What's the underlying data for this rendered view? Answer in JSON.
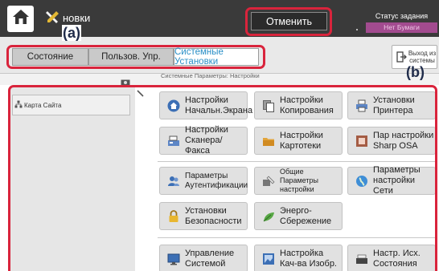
{
  "header": {
    "title": "новки",
    "cancel_label": "Отменить",
    "job_status_title": "Статус задания",
    "job_status_value": "Нет Бумаги"
  },
  "annotations": {
    "a": "(a)",
    "b": "(b)"
  },
  "tabs": [
    {
      "label": "Состояние"
    },
    {
      "label": "Пользов. Упр."
    },
    {
      "label": "Системные Установки",
      "active": true
    }
  ],
  "exit": {
    "label_line1": "Выход из",
    "label_line2": "системы"
  },
  "breadcrumb": "Системные Параметры: Настройки",
  "sidebar": {
    "sitemap_label": "Карта Сайта"
  },
  "tiles": [
    {
      "line1": "Настройки",
      "line2": "Начальн.Экрана",
      "icon": "home-icon"
    },
    {
      "line1": "Настройки",
      "line2": "Копирования",
      "icon": "copy-icon"
    },
    {
      "line1": "Установки",
      "line2": "Принтера",
      "icon": "printer-icon"
    },
    {
      "line1": "Настройки",
      "line2": "Сканера/Факса",
      "icon": "scanner-icon"
    },
    {
      "line1": "Настройки",
      "line2": "Картотеки",
      "icon": "folder-icon"
    },
    {
      "line1": "Пар настройки",
      "line2": "Sharp OSA",
      "icon": "osa-icon"
    },
    {
      "line1": "Параметры",
      "line2": "Аутентификации",
      "icon": "users-icon"
    },
    {
      "line1": "Общие Параметры",
      "line2": "настройки",
      "icon": "common-settings-icon"
    },
    {
      "line1": "Параметры",
      "line2": "настройки Сети",
      "icon": "network-globe-icon"
    },
    {
      "line1": "Установки",
      "line2": "Безопасности",
      "icon": "lock-icon"
    },
    {
      "line1": "Энерго-",
      "line2": "Сбережение",
      "icon": "leaf-icon"
    },
    {
      "line1": "Управление",
      "line2": "Системой",
      "icon": "monitor-icon"
    },
    {
      "line1": "Настройка",
      "line2": "Кач-ва Изобр.",
      "icon": "image-quality-icon"
    },
    {
      "line1": "Настр. Исх.",
      "line2": "Состояния",
      "icon": "restore-defaults-icon"
    }
  ],
  "colors": {
    "highlight": "#d9243c",
    "topbar": "#3a3a3a",
    "active_tab_text": "#2a8fc7",
    "job_status_badge": "#a24b8f"
  }
}
